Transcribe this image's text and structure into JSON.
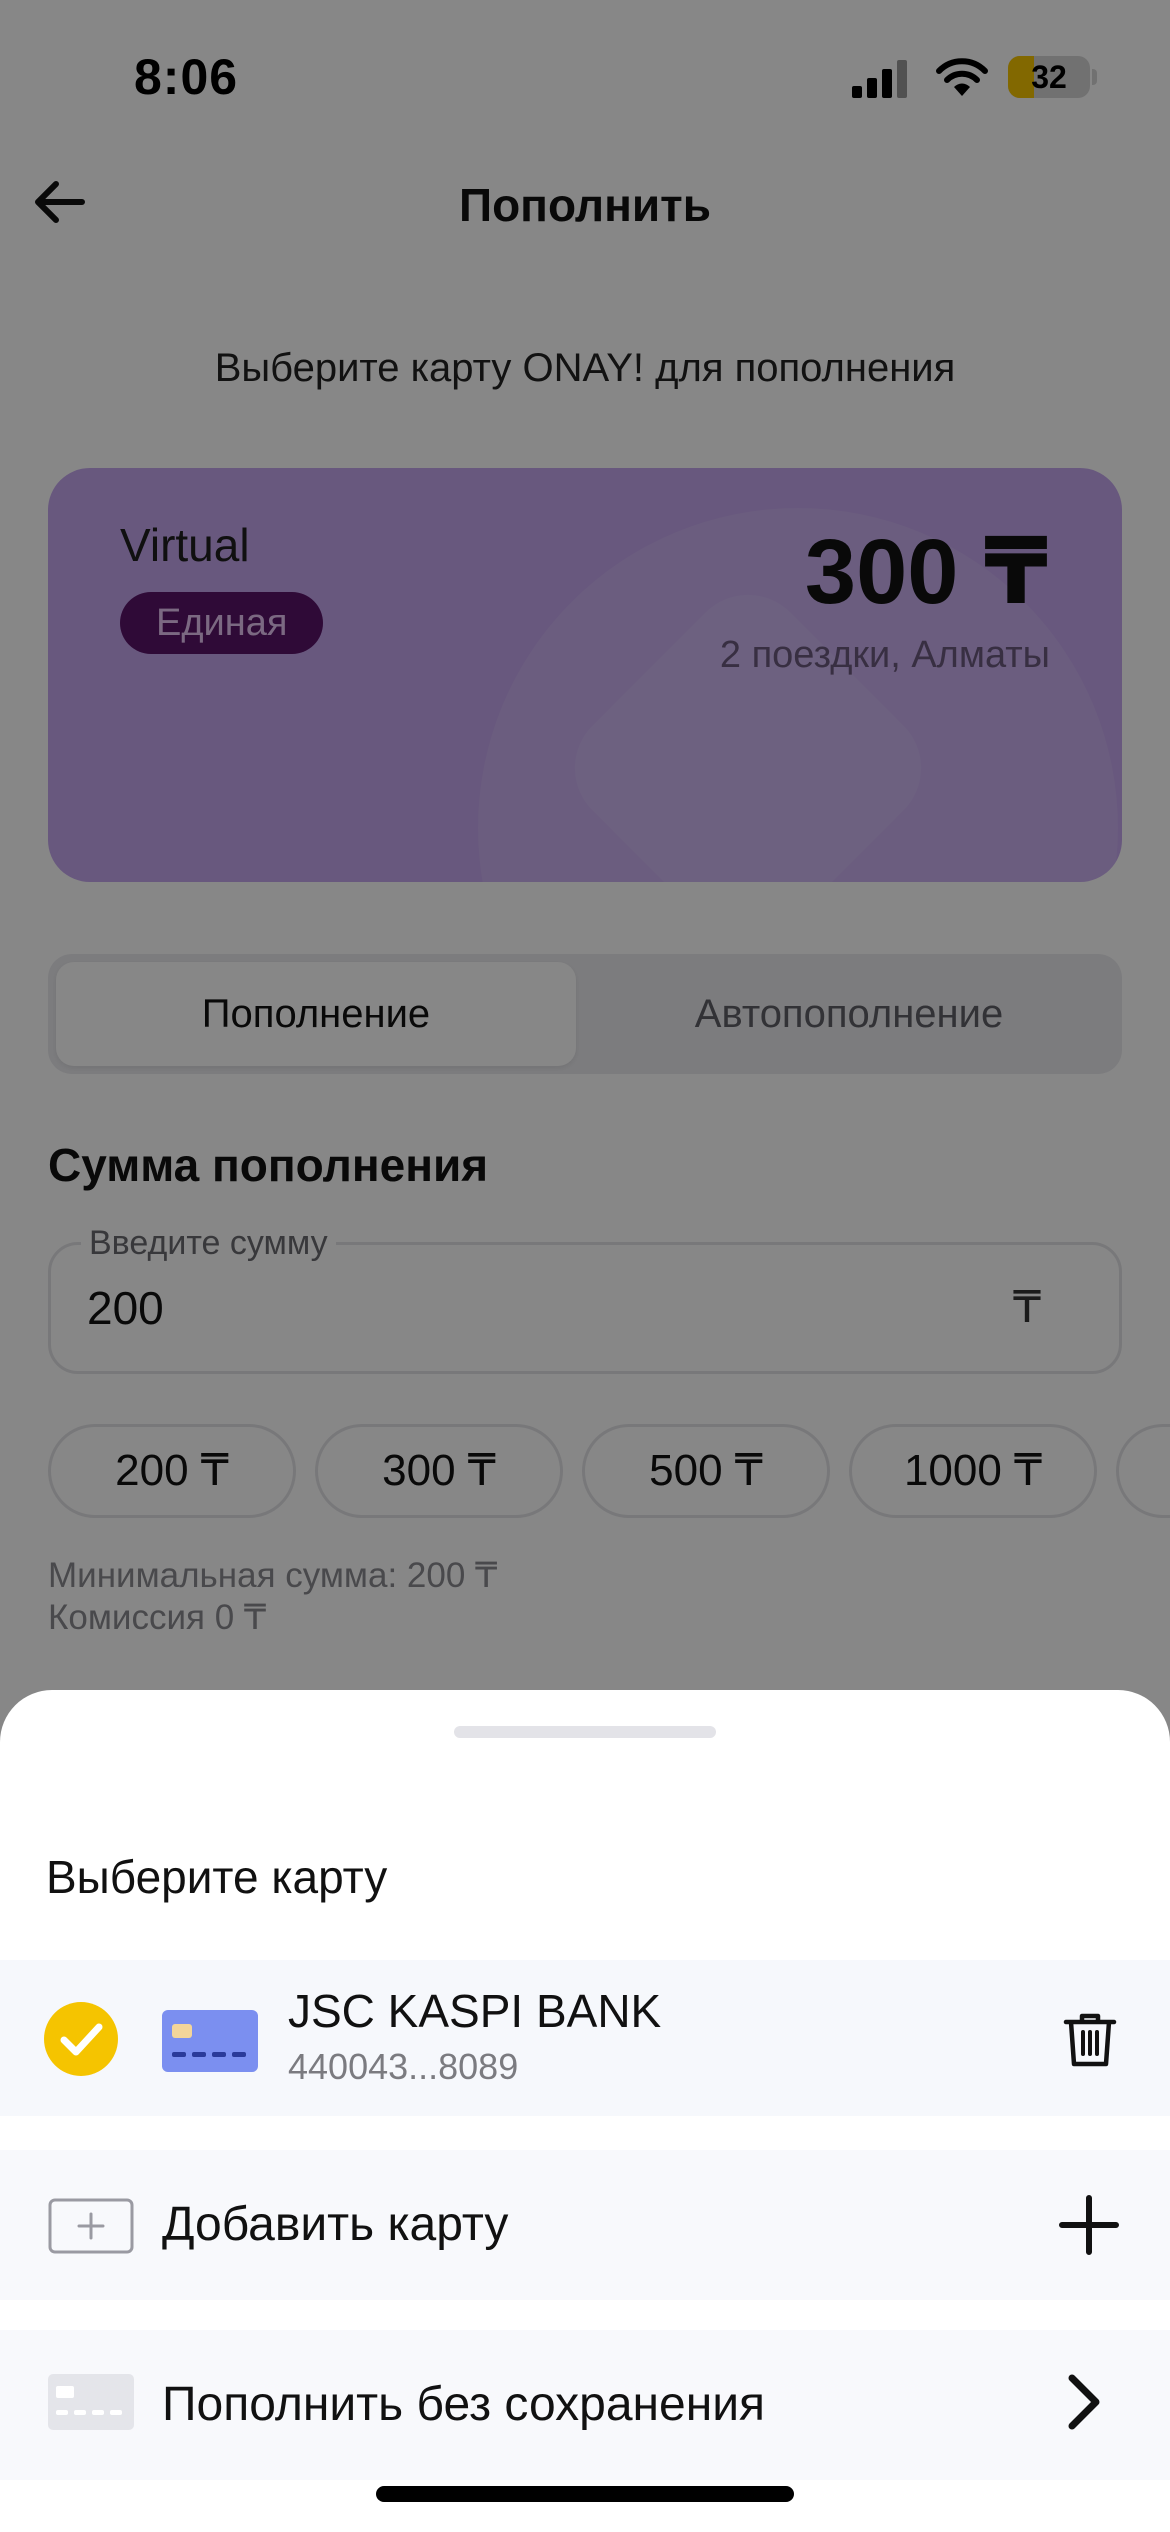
{
  "status_bar": {
    "time": "8:06",
    "battery_level": "32",
    "battery_fraction": 0.32,
    "battery_color": "#f5c400"
  },
  "header": {
    "title": "Пополнить",
    "back_icon": "arrow-left-icon"
  },
  "subtitle": "Выберите карту ONAY! для пополнения",
  "transport_card": {
    "name": "Virtual",
    "badge": "Единая",
    "balance": "300 ₸",
    "trips": "2 поездки, Алматы",
    "color": "#c5a7ef",
    "badge_color": "#5a1368"
  },
  "tabs": [
    {
      "label": "Пополнение",
      "active": true
    },
    {
      "label": "Автопополнение",
      "active": false
    }
  ],
  "amount_section": {
    "title": "Сумма пополнения",
    "field_label": "Введите сумму",
    "value": "200",
    "currency": "₸",
    "chips": [
      "200 ₸",
      "300 ₸",
      "500 ₸",
      "1000 ₸"
    ],
    "min_amount": "Минимальная сумма: 200 ₸",
    "commission": "Комиссия 0 ₸"
  },
  "sheet": {
    "title": "Выберите карту",
    "saved_card": {
      "bank": "JSC KASPI BANK",
      "number": "440043...8089",
      "selected": true,
      "check_color": "#f5c400"
    },
    "add_card_label": "Добавить карту",
    "pay_without_saving_label": "Пополнить без сохранения"
  },
  "icons": {
    "selected": "check-circle-icon",
    "card": "bank-card-icon",
    "delete": "trash-icon",
    "add": "plus-icon",
    "proceed": "chevron-right-icon"
  }
}
